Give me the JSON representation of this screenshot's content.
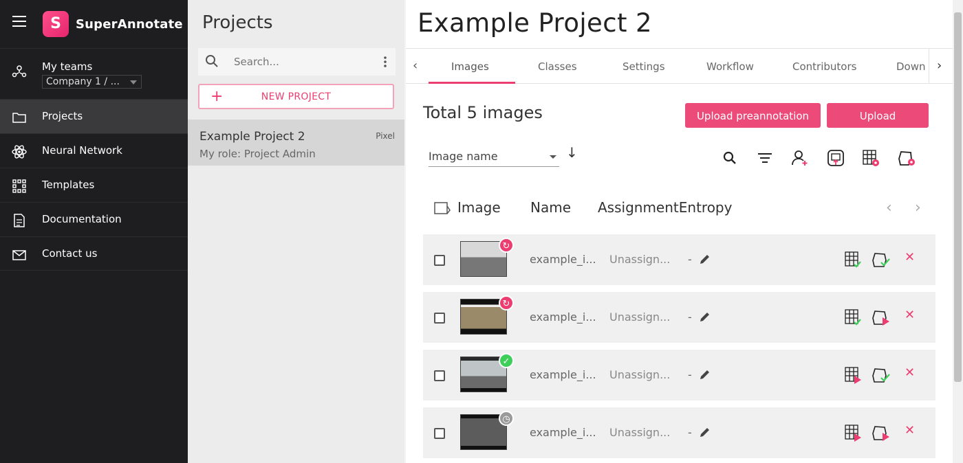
{
  "app": {
    "brand": "SuperAnnotate",
    "logo_letter": "S"
  },
  "sidebar": {
    "team_label": "My teams",
    "team_value": "Company 1 / ...",
    "items": [
      {
        "label": "Projects",
        "icon": "folder-icon",
        "active": true
      },
      {
        "label": "Neural Network",
        "icon": "atom-icon"
      },
      {
        "label": "Templates",
        "icon": "grid-dots-icon"
      },
      {
        "label": "Documentation",
        "icon": "document-icon"
      },
      {
        "label": "Contact us",
        "icon": "mail-icon"
      }
    ]
  },
  "projects": {
    "title": "Projects",
    "search_placeholder": "Search...",
    "new_project_label": "NEW PROJECT",
    "list": [
      {
        "name": "Example Project 2",
        "type": "Pixel",
        "role": "My role: Project Admin"
      }
    ]
  },
  "main": {
    "title": "Example Project 2",
    "tabs": [
      "Images",
      "Classes",
      "Settings",
      "Workflow",
      "Contributors",
      "Down"
    ],
    "active_tab": "Images",
    "total_label": "Total 5 images",
    "upload_preannotation_label": "Upload preannotation",
    "upload_label": "Upload",
    "sort_by": "Image name",
    "columns": [
      "Image",
      "Name",
      "AssignmentEntropy"
    ],
    "rows": [
      {
        "name": "example_i...",
        "assignment": "Unassign...",
        "entropy": "-",
        "status": "returned",
        "status_color": "#ec3d70"
      },
      {
        "name": "example_i...",
        "assignment": "Unassign...",
        "entropy": "-",
        "status": "returned",
        "status_color": "#ec3d70"
      },
      {
        "name": "example_i...",
        "assignment": "Unassign...",
        "entropy": "-",
        "status": "completed",
        "status_color": "#3ecf5a"
      },
      {
        "name": "example_i...",
        "assignment": "Unassign...",
        "entropy": "-",
        "status": "not-started",
        "status_color": "#9a9a9a"
      }
    ]
  },
  "colors": {
    "accent": "#ec3d70",
    "sidebar": "#1e1e20"
  }
}
